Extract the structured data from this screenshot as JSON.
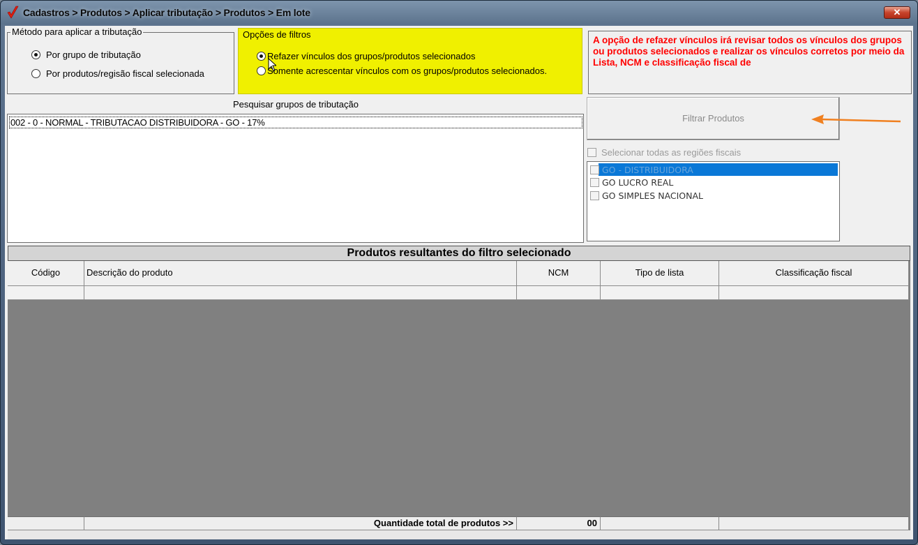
{
  "window": {
    "title": "Cadastros > Produtos > Aplicar tributação > Produtos > Em lote",
    "close_label": "✕"
  },
  "metodo": {
    "legend": "Método para aplicar a tributação",
    "options": [
      {
        "label": "Por grupo de tributação",
        "checked": true
      },
      {
        "label": "Por produtos/regisão fiscal selecionada",
        "checked": false
      }
    ]
  },
  "filtros": {
    "legend": "Opções de filtros",
    "highlight_color": "#f0f000",
    "options": [
      {
        "label": "Refazer vínculos dos grupos/produtos selecionados",
        "checked": true
      },
      {
        "label": "Somente acrescentar vínculos com os grupos/produtos selecionados.",
        "checked": false
      }
    ]
  },
  "info_message": "A opção de refazer vínculos irá revisar todos os vínculos dos grupos ou produtos selecionados e realizar os vínculos corretos por meio da Lista, NCM e classificação fiscal de",
  "groups": {
    "search_label": "Pesquisar grupos de tributação",
    "items": [
      "002 - 0 - NORMAL - TRIBUTACAO DISTRIBUIDORA - GO - 17%"
    ]
  },
  "filter_button": {
    "label": "Filtrar Produtos",
    "arrow_color": "#f08020"
  },
  "regions": {
    "select_all_label": "Selecionar todas as regiões fiscais",
    "items": [
      {
        "label": "GO - DISTRIBUIDORA",
        "selected": true
      },
      {
        "label": "GO LUCRO REAL",
        "selected": false
      },
      {
        "label": "GO SIMPLES NACIONAL",
        "selected": false
      }
    ]
  },
  "results": {
    "title": "Produtos resultantes do filtro selecionado",
    "columns": [
      "Código",
      "Descrição do produto",
      "NCM",
      "Tipo de lista",
      "Classificação fiscal"
    ],
    "footer_label": "Quantidade total de produtos >>",
    "total": "00"
  }
}
